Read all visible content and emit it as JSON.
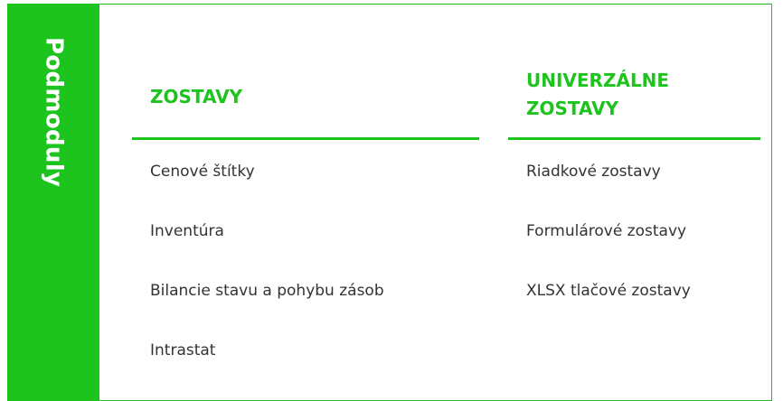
{
  "side_tab": {
    "label": "Podmoduly"
  },
  "columns": [
    {
      "title": "ZOSTAVY",
      "items": [
        {
          "label": "Cenové štítky"
        },
        {
          "label": "Inventúra"
        },
        {
          "label": "Bilancie stavu a pohybu zásob"
        },
        {
          "label": "Intrastat"
        }
      ]
    },
    {
      "title": "UNIVERZÁLNE ZOSTAVY",
      "items": [
        {
          "label": "Riadkové zostavy"
        },
        {
          "label": "Formulárové zostavy"
        },
        {
          "label": "XLSX tlačové zostavy"
        }
      ]
    }
  ],
  "colors": {
    "accent": "#1ec41e",
    "text": "#333333",
    "background": "#ffffff"
  }
}
